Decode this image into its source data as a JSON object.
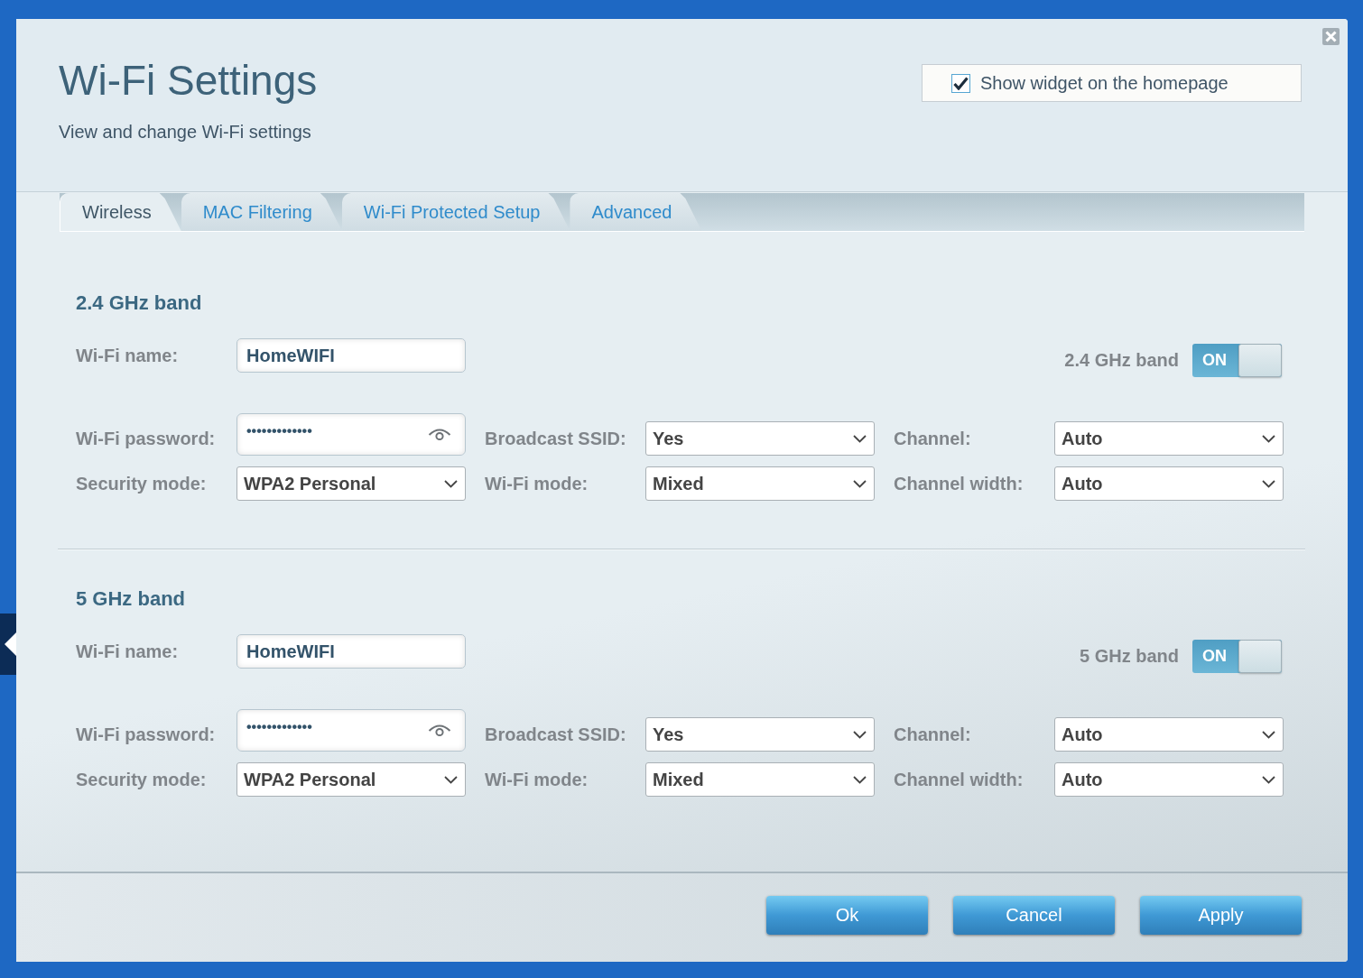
{
  "window": {
    "title": "Wi-Fi Settings",
    "subtitle": "View and change Wi-Fi settings"
  },
  "widget_option": {
    "label": "Show widget on the homepage",
    "checked": true
  },
  "tabs": [
    {
      "label": "Wireless",
      "selected": true
    },
    {
      "label": "MAC Filtering",
      "selected": false
    },
    {
      "label": "Wi-Fi Protected Setup",
      "selected": false
    },
    {
      "label": "Advanced",
      "selected": false
    }
  ],
  "bands": [
    {
      "heading": "2.4 GHz band",
      "wifi_name": {
        "label": "Wi-Fi name:",
        "value": "HomeWIFI"
      },
      "band_switch": {
        "label": "2.4 GHz band",
        "state_label": "ON",
        "on": true
      },
      "wifi_password": {
        "label": "Wi-Fi password:",
        "value": "•••••••••••••"
      },
      "broadcast_ssid": {
        "label": "Broadcast SSID:",
        "value": "Yes"
      },
      "channel": {
        "label": "Channel:",
        "value": "Auto"
      },
      "security_mode": {
        "label": "Security mode:",
        "value": "WPA2 Personal"
      },
      "wifi_mode": {
        "label": "Wi-Fi mode:",
        "value": "Mixed"
      },
      "channel_width": {
        "label": "Channel width:",
        "value": "Auto"
      }
    },
    {
      "heading": "5 GHz band",
      "wifi_name": {
        "label": "Wi-Fi name:",
        "value": "HomeWIFI"
      },
      "band_switch": {
        "label": "5 GHz band",
        "state_label": "ON",
        "on": true
      },
      "wifi_password": {
        "label": "Wi-Fi password:",
        "value": "•••••••••••••"
      },
      "broadcast_ssid": {
        "label": "Broadcast SSID:",
        "value": "Yes"
      },
      "channel": {
        "label": "Channel:",
        "value": "Auto"
      },
      "security_mode": {
        "label": "Security mode:",
        "value": "WPA2 Personal"
      },
      "wifi_mode": {
        "label": "Wi-Fi mode:",
        "value": "Mixed"
      },
      "channel_width": {
        "label": "Channel width:",
        "value": "Auto"
      }
    }
  ],
  "buttons": [
    {
      "label": "Ok"
    },
    {
      "label": "Cancel"
    },
    {
      "label": "Apply"
    }
  ]
}
